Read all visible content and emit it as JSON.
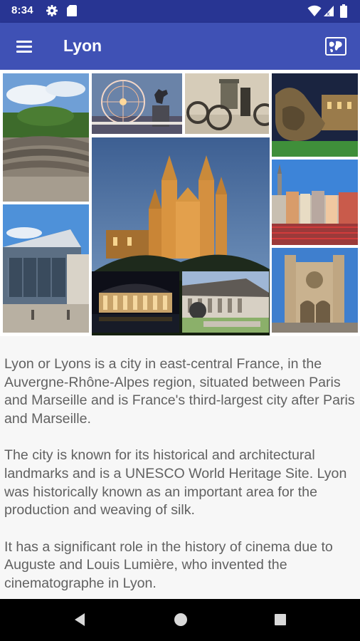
{
  "status_bar": {
    "time": "8:34",
    "left_icons": [
      "gear-icon",
      "sd-card-icon"
    ],
    "right_icons": [
      "wifi-icon",
      "cellular-signal-icon",
      "battery-icon"
    ]
  },
  "app_bar": {
    "title": "Lyon",
    "menu_icon": "hamburger-menu-icon",
    "action_icon": "map-icon"
  },
  "gallery": {
    "tiles": [
      "roman-theatre-photo",
      "ferris-wheel-statue-photo",
      "museum-artifacts-photo",
      "fountain-night-photo",
      "basilica-fourviere-photo",
      "old-town-riverside-photo",
      "modern-building-photo",
      "saint-jean-cathedral-photo",
      "opera-night-photo",
      "museum-building-photo"
    ]
  },
  "article": {
    "paragraphs": [
      "Lyon or Lyons is a city in east-central France, in the Auvergne-Rhône-Alpes region, situated between Paris and Marseille and is France's third-largest city after Paris and Marseille.",
      "The city is known for its historical and architec­tural landmarks and is a UNESCO World Heritage Site. Lyon was historically known as an important area for the production and weaving of silk.",
      "It has a significant role in the history of cinema due to Auguste and Louis Lumière, who invented the cinematographe in Lyon."
    ]
  },
  "colors": {
    "status_bar": "#283593",
    "app_bar": "#3f51b5",
    "body_text": "#616161",
    "nav_bar": "#000000"
  },
  "nav_bar": {
    "buttons": [
      "back-icon",
      "home-icon",
      "recents-icon"
    ]
  }
}
